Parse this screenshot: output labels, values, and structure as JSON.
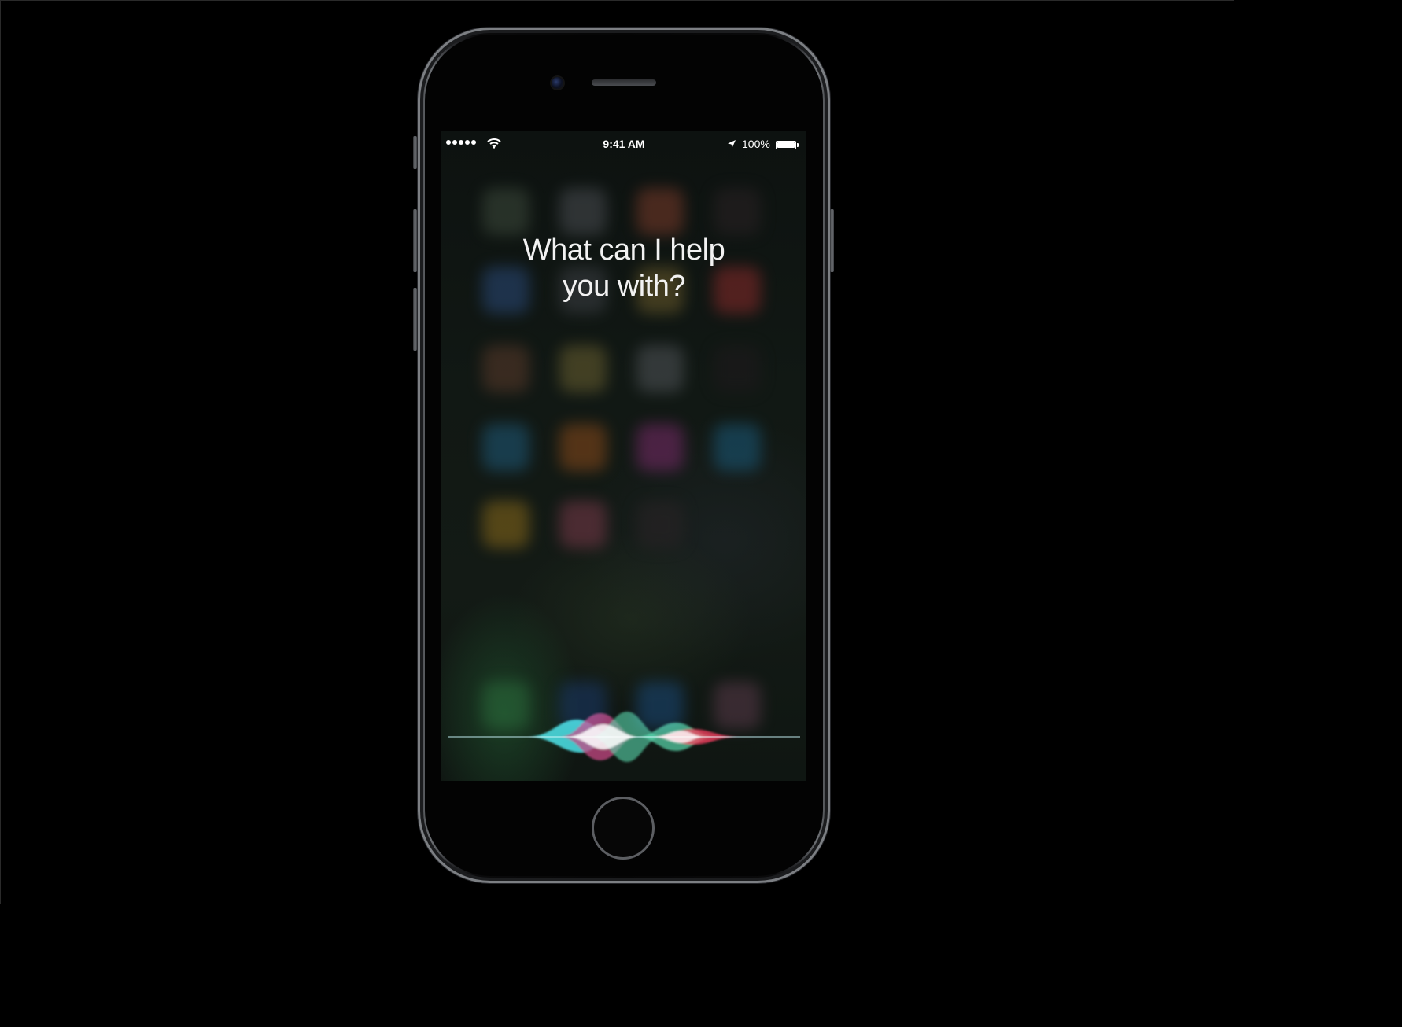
{
  "status_bar": {
    "signal_dots": 5,
    "time": "9:41 AM",
    "battery_percent": "100%",
    "battery_level": 1.0,
    "icons": [
      "signal-dots-icon",
      "wifi-icon",
      "location-arrow-icon",
      "battery-icon"
    ]
  },
  "siri": {
    "prompt_line1": "What can I help",
    "prompt_line2": "you with?"
  },
  "colors": {
    "background": "#000000",
    "wave_cyan": "#3fe0e8",
    "wave_magenta": "#c2367a",
    "wave_green": "#4fd6a6",
    "wave_red": "#ff2f55"
  }
}
